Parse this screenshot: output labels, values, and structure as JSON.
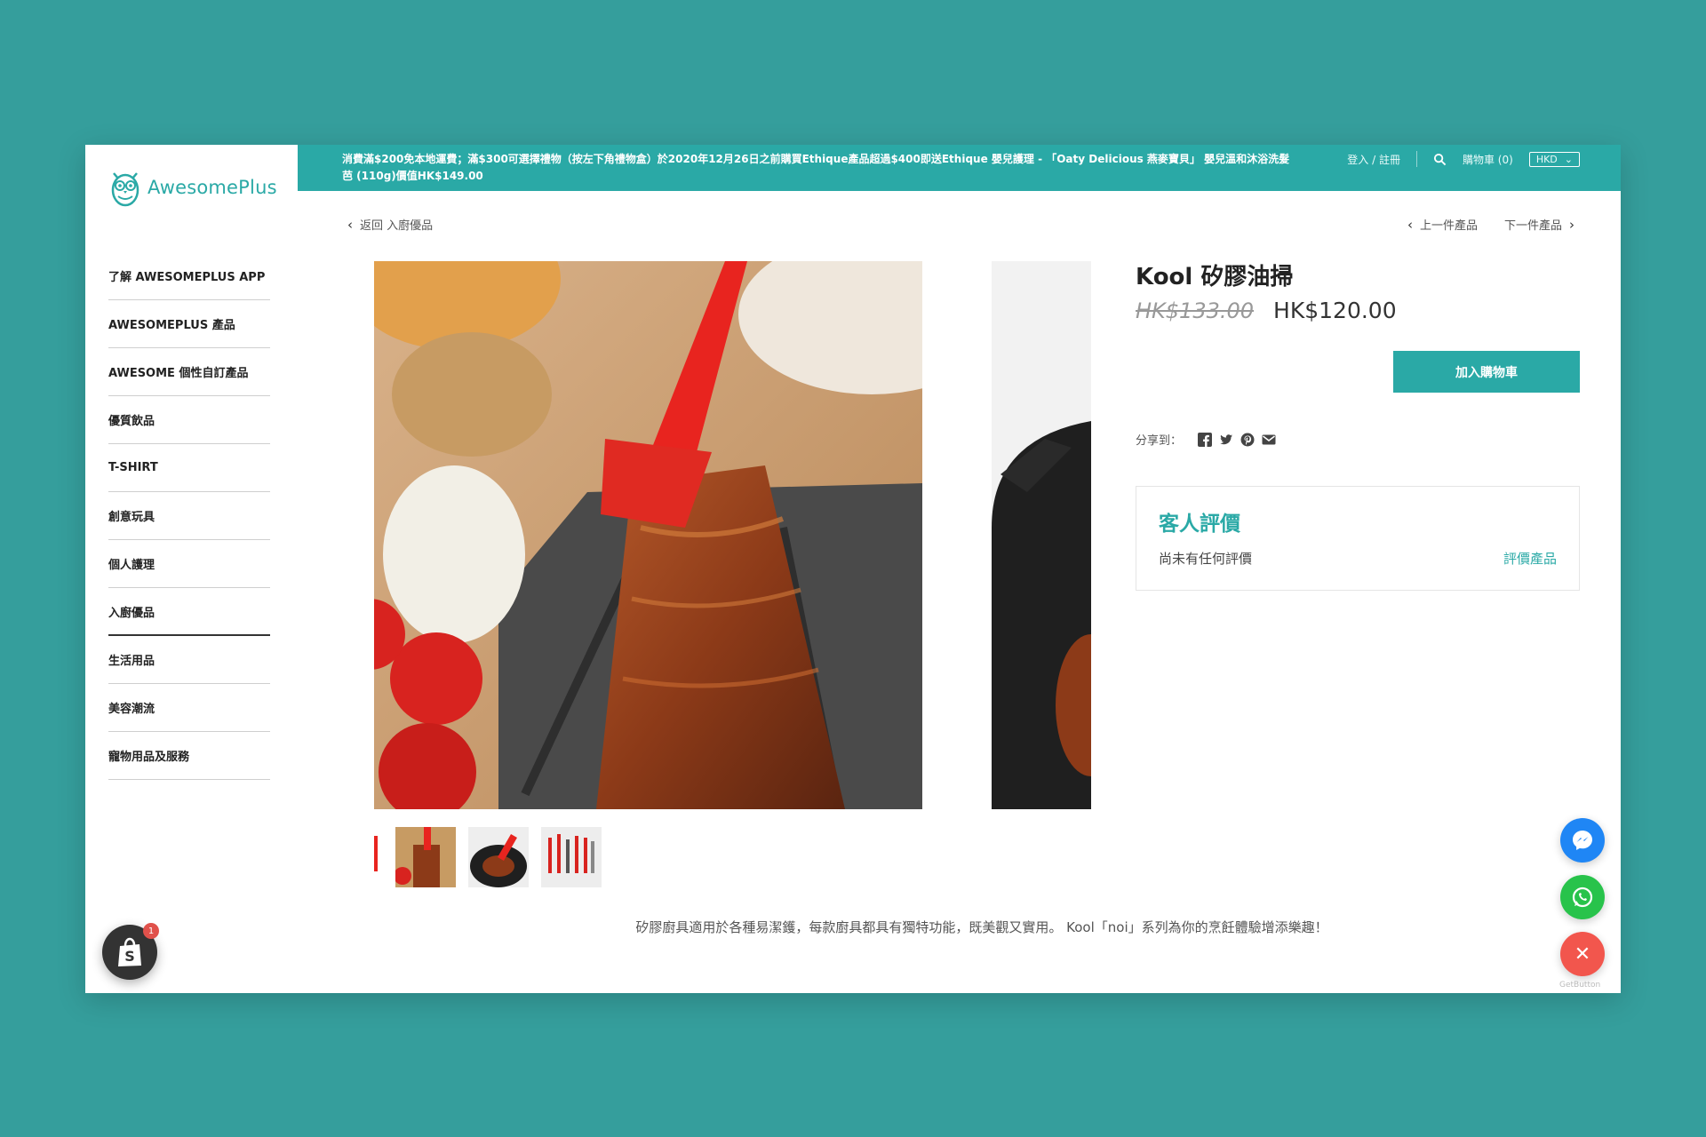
{
  "brand": {
    "name": "AwesomePlus",
    "accent": "#2aa9a6"
  },
  "sidebar": {
    "items": [
      {
        "label": "了解 AWESOMEPLUS APP"
      },
      {
        "label": "AWESOMEPLUS 產品"
      },
      {
        "label": "AWESOME 個性自訂產品"
      },
      {
        "label": "優質飲品"
      },
      {
        "label": "T-SHIRT"
      },
      {
        "label": "創意玩具"
      },
      {
        "label": "個人護理"
      },
      {
        "label": "入廚優品"
      },
      {
        "label": "生活用品"
      },
      {
        "label": "美容潮流"
      },
      {
        "label": "寵物用品及服務"
      }
    ]
  },
  "announcement": {
    "text": "消費滿$200免本地運費；滿$300可選擇禮物（按左下角禮物盒）於2020年12月26日之前購買Ethique產品超過$400即送Ethique 嬰兒護理 - 「Oaty Delicious 燕麥寶貝」 嬰兒溫和沐浴洗髮芭 (110g)價值HK$149.00"
  },
  "topbar": {
    "login": "登入 / 註冊",
    "cart": "購物車 (0)",
    "currency": "HKD"
  },
  "nav": {
    "back": "返回 入廚優品",
    "prev": "上一件產品",
    "next": "下一件產品"
  },
  "product": {
    "title": "Kool 矽膠油掃",
    "old_price": "HK$133.00",
    "price": "HK$120.00",
    "add_to_cart": "加入購物車",
    "share_label": "分享到：",
    "description": "矽膠廚具適用於各種易潔鑊，每款廚具都具有獨特功能，既美觀又實用。 Kool「noi」系列為你的烹飪體驗增添樂趣！"
  },
  "reviews": {
    "title": "客人評價",
    "empty": "尚未有任何評價",
    "link": "評價產品"
  },
  "widgets": {
    "shopify_badge": "1",
    "getbutton": "GetButton"
  }
}
